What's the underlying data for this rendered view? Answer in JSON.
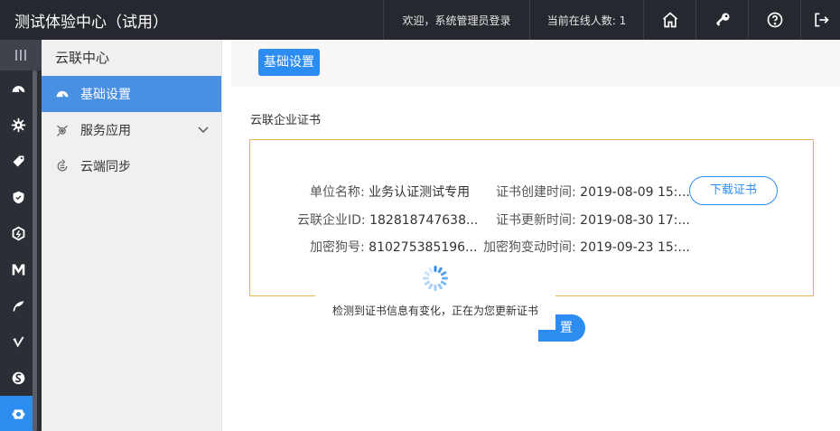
{
  "header": {
    "app_title": "测试体验中心（试用）",
    "welcome": "欢迎，系统管理员登录",
    "online_users": "当前在线人数: 1"
  },
  "sidebar": {
    "title": "云联中心",
    "items": [
      {
        "label": "基础设置",
        "icon": "dashboard-icon",
        "active": true
      },
      {
        "label": "服务应用",
        "icon": "service-icon",
        "expandable": true
      },
      {
        "label": "云端同步",
        "icon": "sync-icon"
      }
    ]
  },
  "rail_icons": [
    "menu-toggle-icon",
    "dashboard-icon",
    "gear-icon",
    "tag-icon",
    "shield-icon",
    "hexagon-icon",
    "m-logo-icon",
    "leaf-icon",
    "check-v-icon",
    "s-logo-icon",
    "settings-icon"
  ],
  "main": {
    "tab_label": "基础设置",
    "section_title": "云联企业证书",
    "cert": {
      "unit_name_label": "单位名称:",
      "unit_name_value": "业务认证测试专用",
      "enterprise_id_label": "云联企业ID:",
      "enterprise_id_value": "182818747638...",
      "dongle_label": "加密狗号:",
      "dongle_value": "810275385196...",
      "created_label": "证书创建时间:",
      "created_value": "2019-08-09 15:...",
      "updated_label": "证书更新时间:",
      "updated_value": "2019-08-30 17:...",
      "dongle_changed_label": "加密狗变动时间:",
      "dongle_changed_value": "2019-09-23 15:...",
      "download_button": "下载证书"
    },
    "partial_button": "置",
    "loading_text": "检测到证书信息有变化，正在为您更新证书"
  },
  "colors": {
    "topbar": "#25282f",
    "accent": "#2d8cf0",
    "active_sidebar": "#4a90e2",
    "cert_border": "#e0b84f"
  }
}
